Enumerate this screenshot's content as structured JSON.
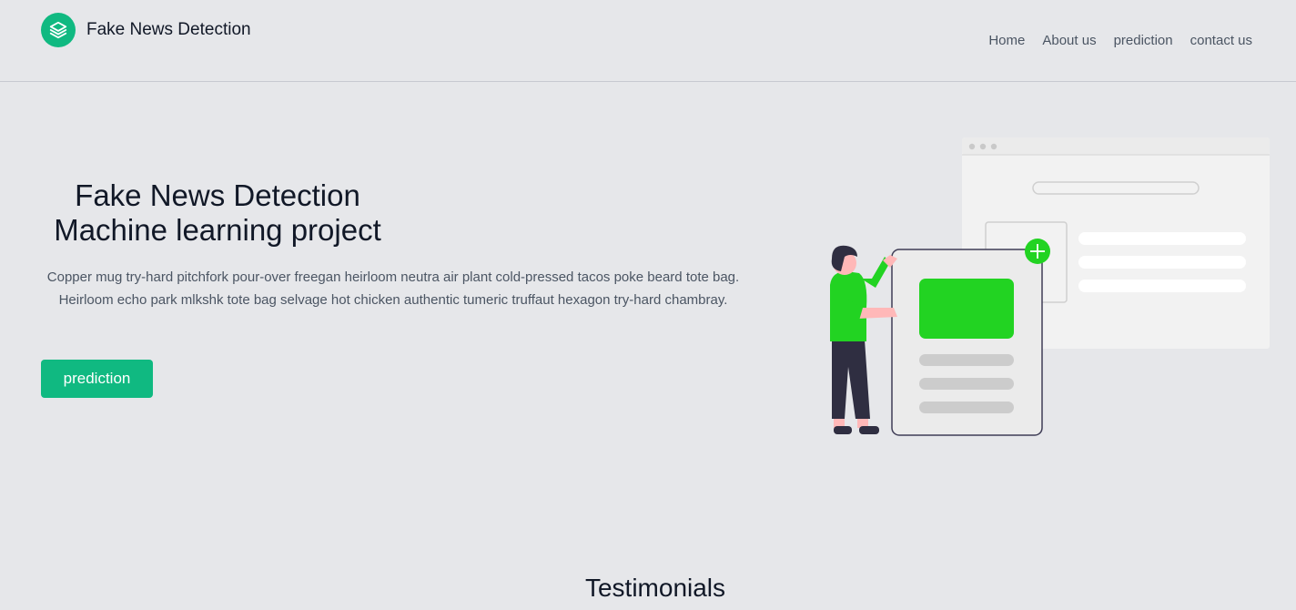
{
  "header": {
    "brand_name": "Fake News Detection",
    "logo_icon": "stacked-layers-icon",
    "nav": [
      "Home",
      "About us",
      "prediction",
      "contact us"
    ]
  },
  "hero": {
    "title_line1": "Fake News Detection",
    "title_line2": "Machine learning project",
    "description": "Copper mug try-hard pitchfork pour-over freegan heirloom neutra air plant cold-pressed tacos poke beard tote bag. Heirloom echo park mlkshk tote bag selvage hot chicken authentic tumeric truffaut hexagon try-hard chambray.",
    "cta_label": "prediction"
  },
  "testimonials": {
    "heading": "Testimonials"
  },
  "colors": {
    "accent": "#10b981",
    "illustration_green": "#22d322",
    "background": "#e6e7ea"
  }
}
